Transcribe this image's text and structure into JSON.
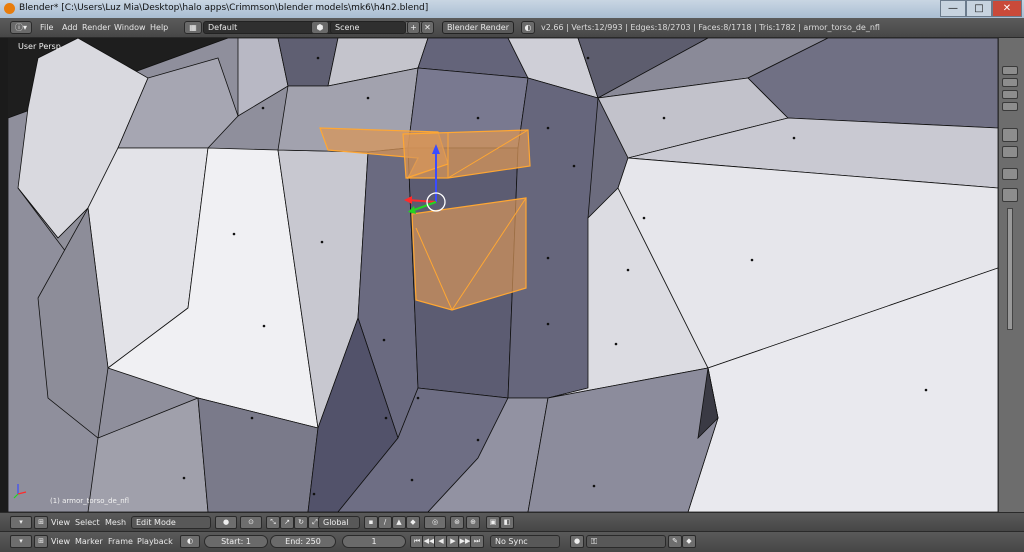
{
  "window": {
    "title": "Blender* [C:\\Users\\Luz Mia\\Desktop\\halo apps\\Crimmson\\blender models\\mk6\\h4n2.blend]",
    "minimize_glyph": "—",
    "maximize_glyph": "□",
    "close_glyph": "✕"
  },
  "info_header": {
    "menus": [
      "File",
      "Add",
      "Render",
      "Window",
      "Help"
    ],
    "screen_layout": "Default",
    "scene": "Scene",
    "render_engine": "Blender Render",
    "stats": "v2.66 | Verts:12/993 | Edges:18/2703 | Faces:8/1718 | Tris:1782 | armor_torso_de_nfl"
  },
  "viewport": {
    "view_label": "User Persp",
    "object_label": "(1) armor_torso_de_nfl"
  },
  "view3d_header": {
    "menus": [
      "View",
      "Select",
      "Mesh"
    ],
    "mode": "Edit Mode",
    "orientation": "Global"
  },
  "timeline_header": {
    "menus": [
      "View",
      "Marker",
      "Frame",
      "Playback"
    ],
    "start_frame": "Start: 1",
    "end_frame": "End: 250",
    "current_frame": "1",
    "sync_mode": "No Sync"
  },
  "icons": [
    "blender-logo-icon",
    "screen-layout-icon",
    "scene-icon",
    "mode-icon",
    "shading-icon",
    "pivot-icon",
    "manipulator-icon",
    "snap-icon",
    "proportional-icon",
    "record-icon",
    "keying-icon",
    "play-icon",
    "rewind-icon",
    "jump-end-icon"
  ],
  "colors": {
    "selection_face": "#d7965a",
    "selection_edge": "#ffa733",
    "mesh_face_light": "#d9d9df",
    "mesh_face_dark": "#6c6c80",
    "background": "#393939"
  }
}
